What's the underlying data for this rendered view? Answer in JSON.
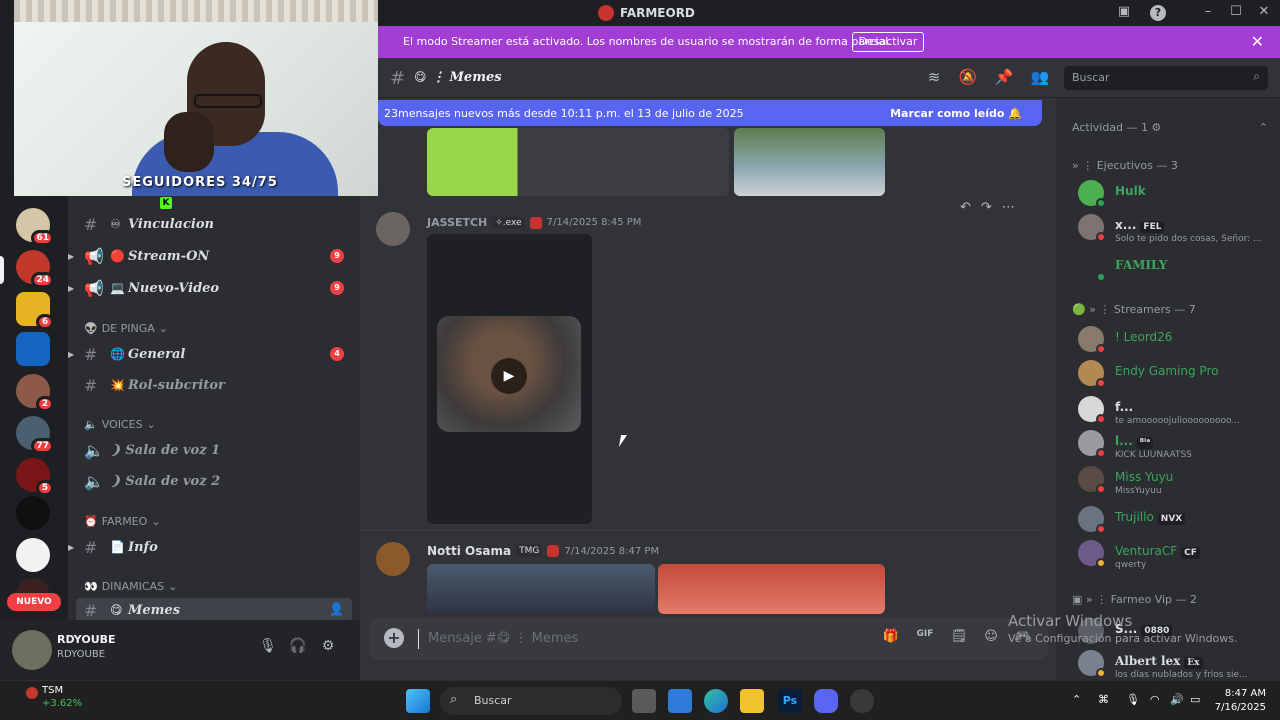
{
  "window": {
    "app_title": "FARMEORD"
  },
  "banner": {
    "text": "El modo Streamer está activado. Los nombres de usuario se mostrarán de forma parcial.",
    "button": "Desactivar"
  },
  "webcam": {
    "overlay_text": "SEGUIDORES 34/75",
    "kick_glyph": "K"
  },
  "rail": {
    "badges": [
      "61",
      "24",
      "6",
      "2",
      "77",
      "5"
    ],
    "new_label": "NUEVO"
  },
  "sidebar": {
    "channels_top": [
      {
        "emoji": "♾",
        "name": "Vinculacion"
      },
      {
        "emoji": "🔴",
        "name": "Stream-ON",
        "count": "9"
      },
      {
        "emoji": "💻",
        "name": "Nuevo-Video",
        "count": "9"
      }
    ],
    "cat_pinga": "DE PINGA",
    "channel_general": {
      "emoji": "🌐",
      "name": "General",
      "count": "4"
    },
    "channel_rol": {
      "emoji": "💥",
      "name": "Rol-subcritor"
    },
    "cat_voices": "VOICES",
    "voice1": "❩ Sala de voz 1",
    "voice2": "❩ Sala de voz 2",
    "cat_farmeo": "FARMEO",
    "channel_info": {
      "emoji": "📄",
      "name": "Info"
    },
    "cat_dinamicas": "DINAMICAS",
    "channel_memes": {
      "emoji": "😋",
      "name": "Memes"
    }
  },
  "user": {
    "name": "RDYOUBE",
    "sub": "RDYOUBE"
  },
  "channel_header": {
    "title": "Memes",
    "search_placeholder": "Buscar"
  },
  "new_messages": {
    "text": "23mensajes nuevos más desde 10:11 p.m. el 13 de julio de 2025",
    "mark_read": "Marcar como leído"
  },
  "messages": [
    {
      "author": "JASSETCH",
      "tag": "✧.exe",
      "time": "7/14/2025 8:45 PM",
      "author_color": "#949ba4"
    },
    {
      "author": "Notti Osama",
      "tag": "TMG",
      "time": "7/14/2025 8:47 PM",
      "author_color": "#dbdee1"
    }
  ],
  "composer": {
    "placeholder": "Mensaje #😋 ⋮ Memes"
  },
  "members": {
    "activity_header": "Actividad — 1",
    "ejecutivos_header": "Ejecutivos — 3",
    "ejecutivos": [
      {
        "name": "Hulk",
        "color": "#3ba55d"
      },
      {
        "name": "x...",
        "tag": "FEL",
        "status": "Solo te pido dos cosas, Señor: ...",
        "color": "#dbdee1"
      },
      {
        "name": "FAMILY",
        "color": "#3ba55d"
      }
    ],
    "streamers_header": "Streamers — 7",
    "streamers": [
      {
        "name": "! Leord26",
        "color": "#3ba55d"
      },
      {
        "name": "Endy Gaming Pro",
        "color": "#3ba55d"
      },
      {
        "name": "f...",
        "status": "te amooooojuliooooooooo...",
        "color": "#dbdee1"
      },
      {
        "name": "l...",
        "tag": "ᴮˡᵃ",
        "status": "KICK LUUNAATSS",
        "color": "#3ba55d"
      },
      {
        "name": "Miss Yuyu",
        "status": "MissYuyuu",
        "color": "#3ba55d"
      },
      {
        "name": "Trujillo",
        "tag": "NVX",
        "color": "#3ba55d"
      },
      {
        "name": "VenturaCF",
        "tag": "CF",
        "status": "qwerty",
        "color": "#3ba55d"
      }
    ],
    "vip_header": "Farmeo Vip — 2",
    "vip": [
      {
        "name": "S...",
        "tag": "0880",
        "color": "#dbdee1"
      },
      {
        "name": "Albert lex",
        "tag": "Ex",
        "status": "los días nublados y fríos sie...",
        "color": "#dbdee1"
      }
    ]
  },
  "watermark": {
    "line1": "Activar Windows",
    "line2": "Ve a Configuración para activar Windows."
  },
  "taskbar": {
    "stock_name": "TSM",
    "stock_change": "+3.62%",
    "search": "Buscar",
    "time": "8:47 AM",
    "date": "7/16/2025"
  }
}
